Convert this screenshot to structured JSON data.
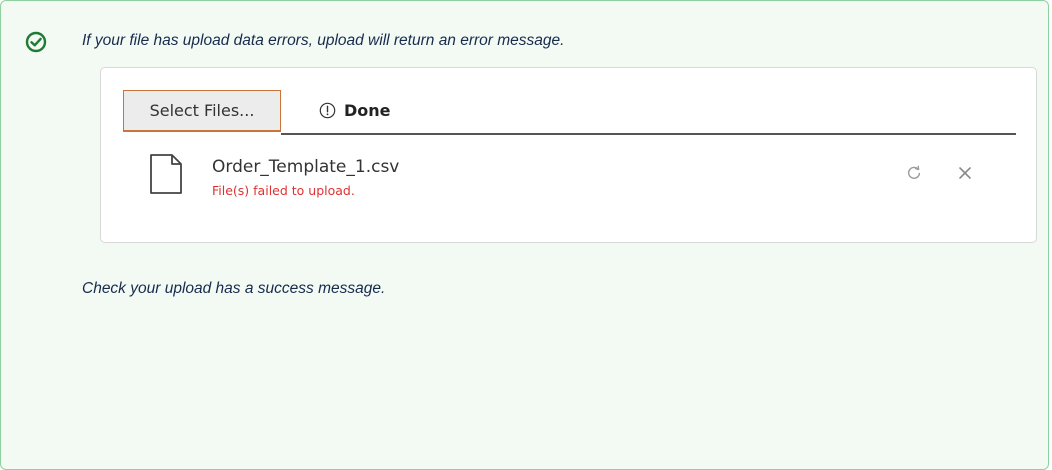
{
  "notes": {
    "top": "If your file has upload data errors, upload will return an error message.",
    "bottom": "Check your upload has a success message."
  },
  "uploader": {
    "select_label": "Select Files...",
    "status_label": "Done",
    "status_icon": "exclamation-circle-icon",
    "files": [
      {
        "name": "Order_Template_1.csv",
        "error": "File(s) failed to upload.",
        "icon": "file-icon",
        "actions": [
          "retry-icon",
          "close-icon"
        ]
      }
    ]
  },
  "colors": {
    "panel_bg": "#f3faf3",
    "panel_border": "#8fd19e",
    "success_icon": "#1e7a35",
    "button_border": "#c8743b",
    "error_text": "#e03131"
  },
  "icons": {
    "note": "check-circle-icon"
  }
}
